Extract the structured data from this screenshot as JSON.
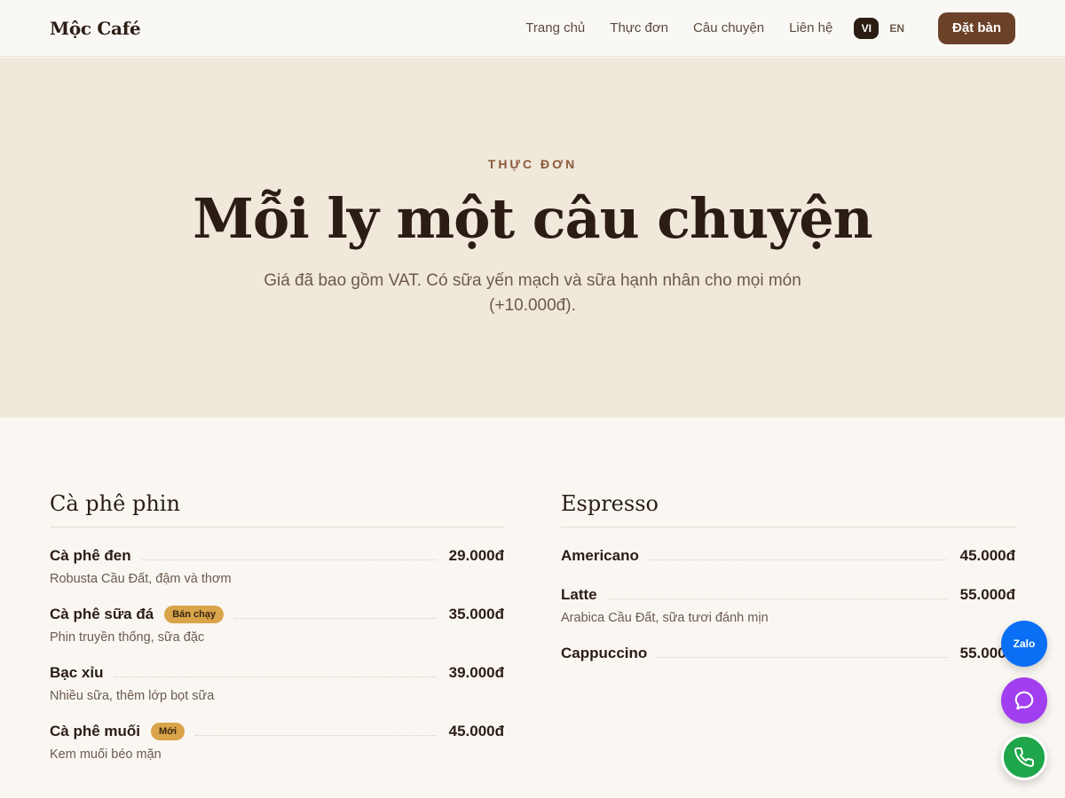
{
  "nav": {
    "logo": "Mộc Café",
    "links": [
      "Trang chủ",
      "Thực đơn",
      "Câu chuyện",
      "Liên hệ"
    ],
    "lang_active": "VI",
    "lang_other": "EN",
    "book_label": "Đặt bàn"
  },
  "hero": {
    "eyebrow": "THỰC ĐƠN",
    "title": "Mỗi ly một câu chuyện",
    "subtitle": "Giá đã bao gồm VAT. Có sữa yến mạch và sữa hạnh nhân cho mọi món (+10.000đ)."
  },
  "menu": {
    "left": {
      "title": "Cà phê phin",
      "items": [
        {
          "name": "Cà phê đen",
          "badge": "",
          "price": "29.000đ",
          "desc": "Robusta Cầu Đất, đậm và thơm"
        },
        {
          "name": "Cà phê sữa đá",
          "badge": "Bán chạy",
          "price": "35.000đ",
          "desc": "Phin truyền thống, sữa đặc"
        },
        {
          "name": "Bạc xỉu",
          "badge": "",
          "price": "39.000đ",
          "desc": "Nhiều sữa, thêm lớp bọt sữa"
        },
        {
          "name": "Cà phê muối",
          "badge": "Mới",
          "price": "45.000đ",
          "desc": "Kem muối béo mặn"
        }
      ]
    },
    "right": {
      "title": "Espresso",
      "items": [
        {
          "name": "Americano",
          "badge": "",
          "price": "45.000đ",
          "desc": ""
        },
        {
          "name": "Latte",
          "badge": "",
          "price": "55.000đ",
          "desc": "Arabica Cầu Đất, sữa tươi đánh mịn"
        },
        {
          "name": "Cappuccino",
          "badge": "",
          "price": "55.000đ",
          "desc": ""
        }
      ]
    }
  },
  "fabs": {
    "zalo_label": "Zalo",
    "chat_icon": "chat-bubble-icon",
    "phone_icon": "phone-icon"
  },
  "colors": {
    "accent": "#6b4128",
    "hero_bg": "#f1e8dc",
    "badge": "#d9a44a",
    "zalo": "#0b6ff5",
    "chat": "#a13ff0",
    "phone": "#1fa64a"
  }
}
